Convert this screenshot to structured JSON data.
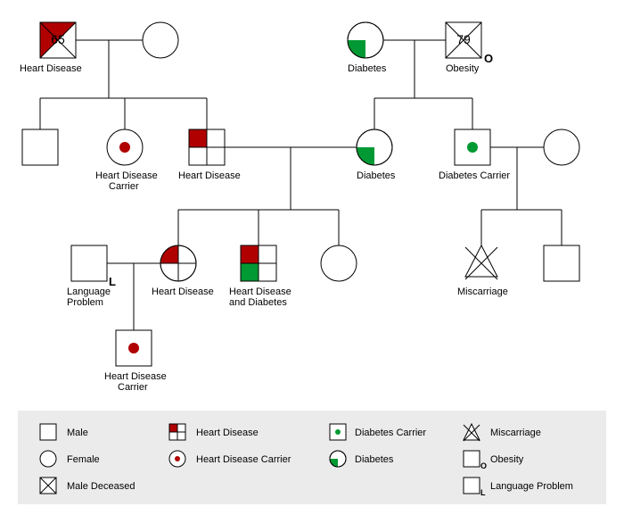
{
  "people": {
    "g1_m1": {
      "age": "65",
      "label": "Heart Disease"
    },
    "g1_f1": {
      "label": ""
    },
    "g1_f2": {
      "label": "Diabetes"
    },
    "g1_m2": {
      "age": "79",
      "label": "Obesity",
      "tag": "O"
    },
    "g2_m1": {
      "label": ""
    },
    "g2_f1": {
      "label": "Heart Disease\nCarrier"
    },
    "g2_m2": {
      "label": "Heart Disease"
    },
    "g2_f2": {
      "label": "Diabetes"
    },
    "g2_m3": {
      "label": "Diabetes Carrier"
    },
    "g2_f3": {
      "label": ""
    },
    "g3_m1": {
      "label": "Language\nProblem",
      "tag": "L"
    },
    "g3_f1": {
      "label": "Heart Disease"
    },
    "g3_m2": {
      "label": "Heart Disease\nand Diabetes"
    },
    "g3_f2": {
      "label": ""
    },
    "g3_x1": {
      "label": "Miscarriage"
    },
    "g3_m3": {
      "label": ""
    },
    "g4_m1": {
      "label": "Heart Disease\nCarrier"
    }
  },
  "legend": {
    "male": "Male",
    "female": "Female",
    "male_deceased": "Male Deceased",
    "heart_disease": "Heart Disease",
    "heart_disease_carrier": "Heart Disease Carrier",
    "diabetes_carrier": "Diabetes Carrier",
    "diabetes": "Diabetes",
    "miscarriage": "Miscarriage",
    "obesity": "Obesity",
    "language_problem": "Language Problem"
  },
  "colors": {
    "red": "#b00000",
    "green": "#009933",
    "stroke": "#000000",
    "legend_bg": "#ebebeb"
  }
}
